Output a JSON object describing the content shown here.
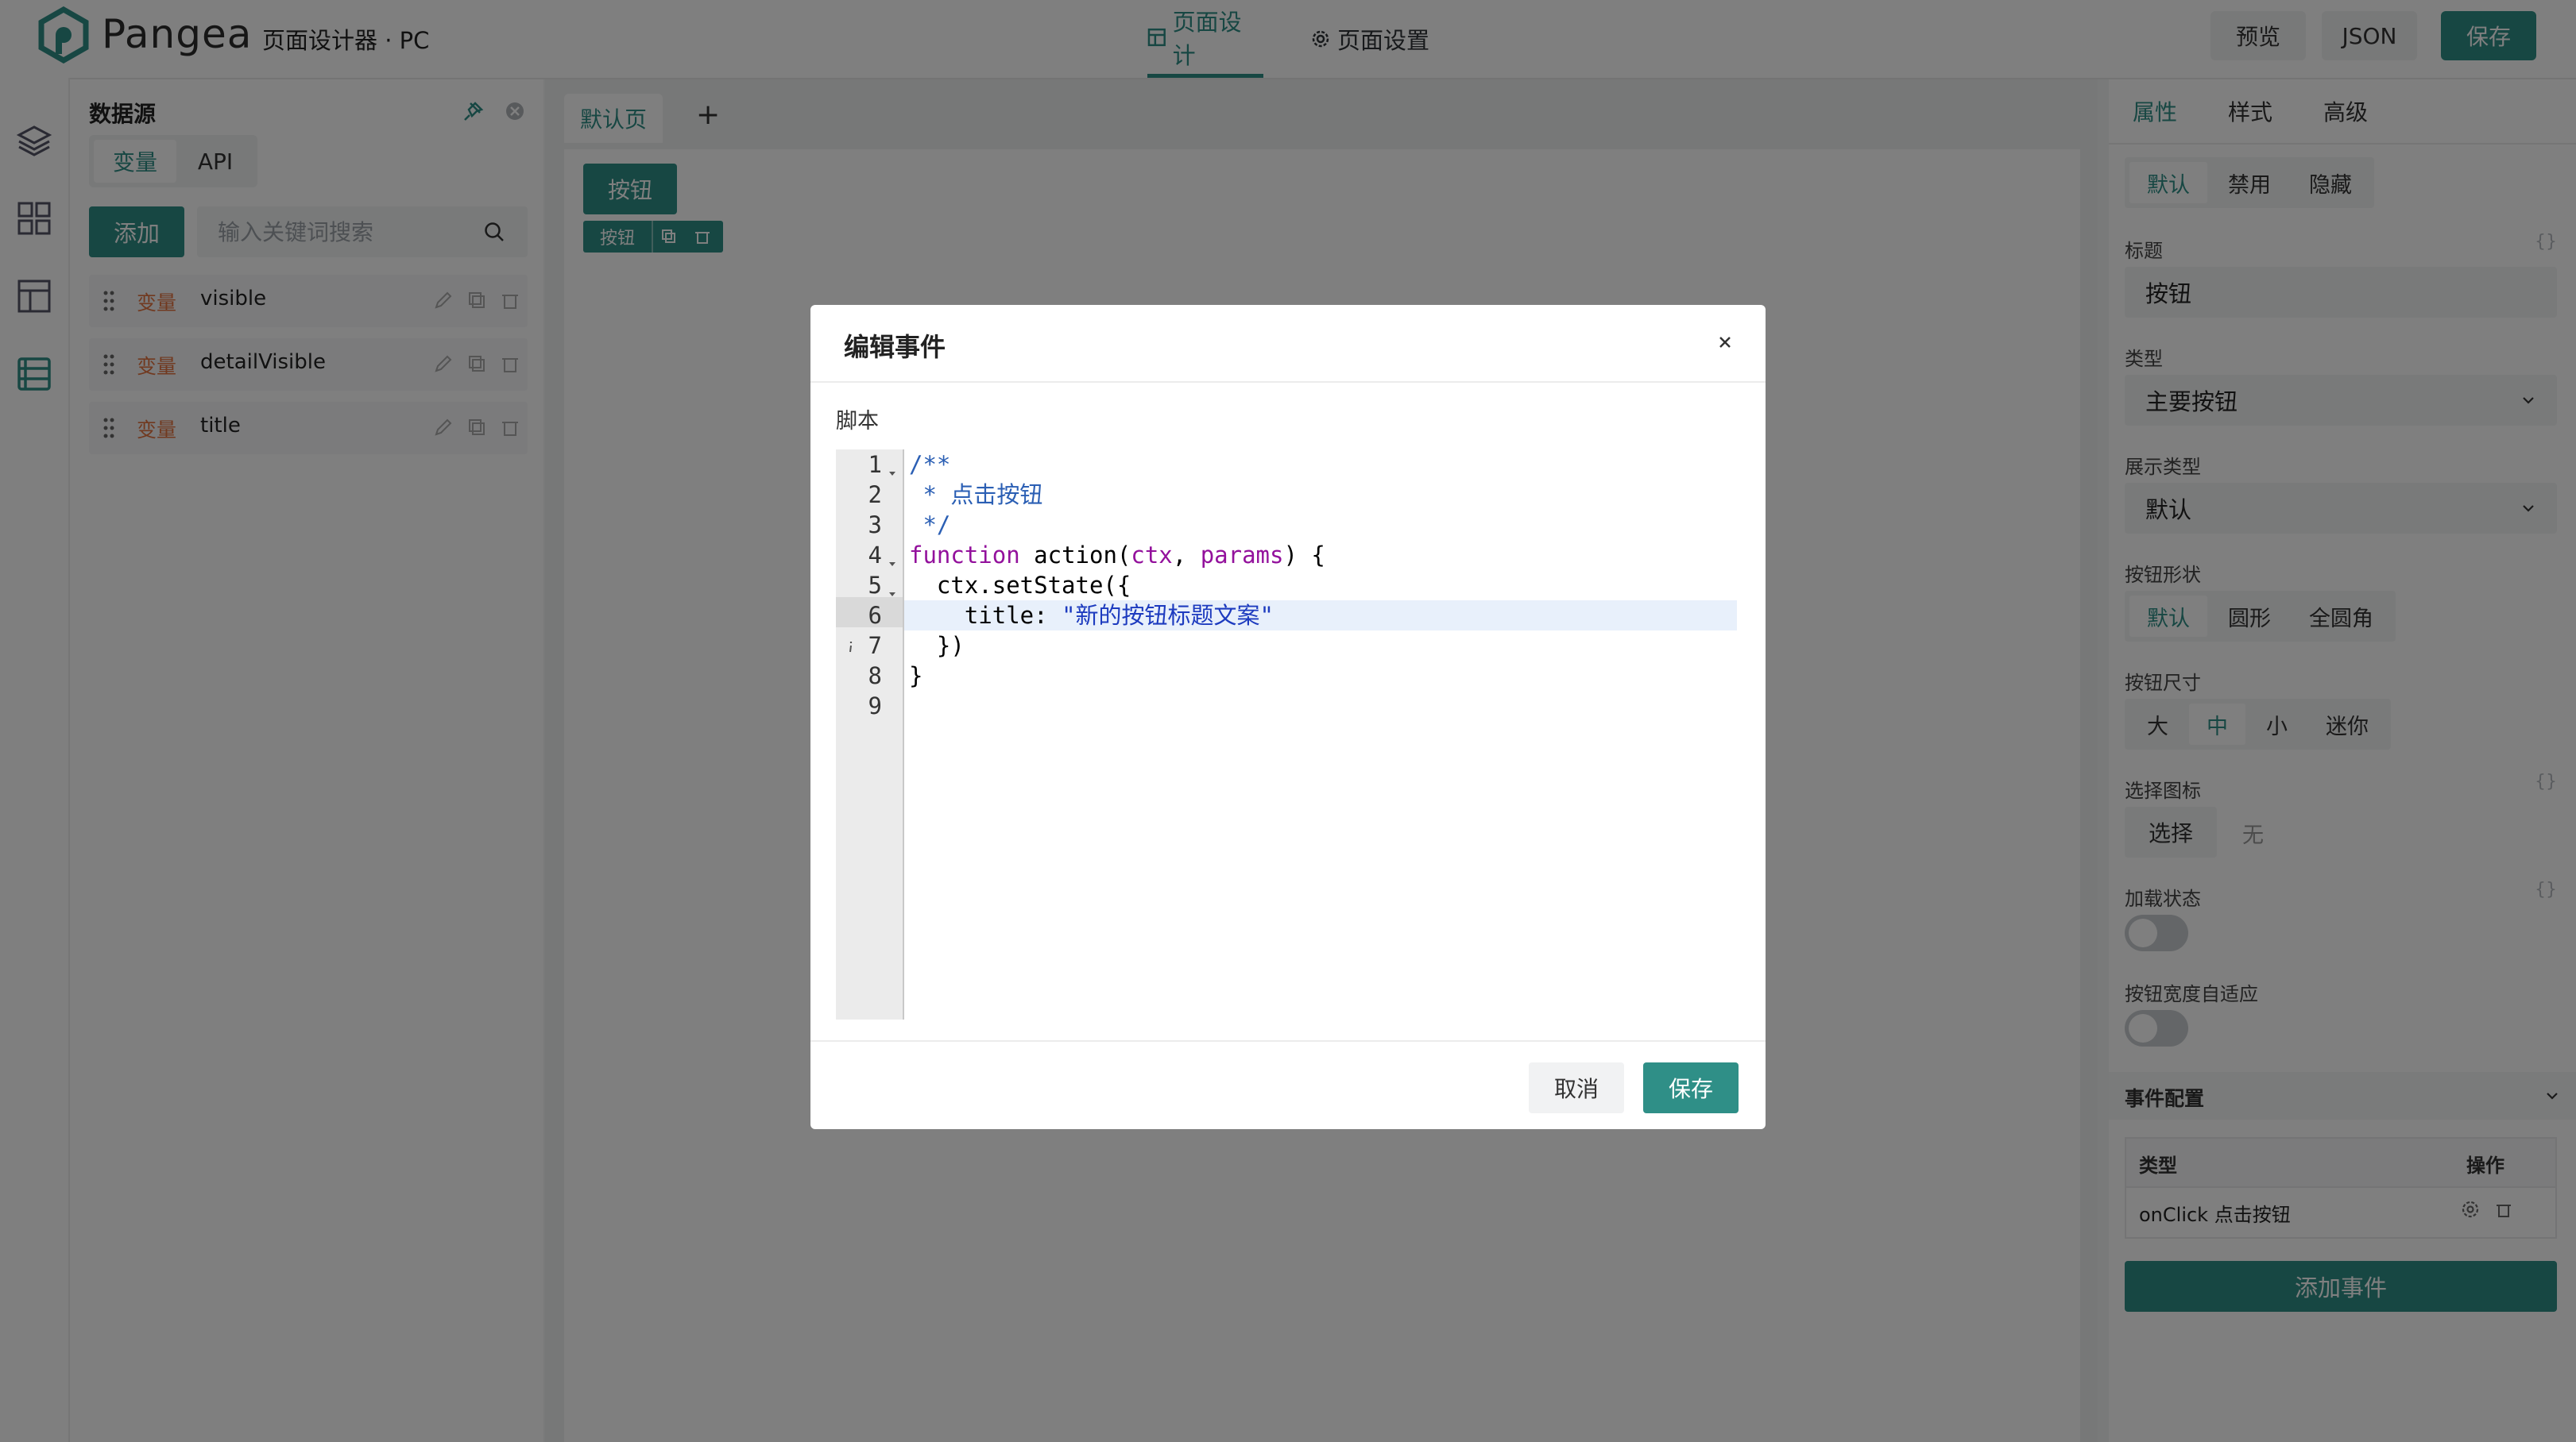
{
  "app": {
    "logo_text": "Pangea",
    "subtitle": "页面设计器 · PC"
  },
  "header": {
    "tabs": [
      {
        "label": "页面设计",
        "icon": "layout-icon",
        "active": true
      },
      {
        "label": "页面设置",
        "icon": "gear-icon",
        "active": false
      }
    ],
    "buttons": {
      "preview": "预览",
      "json": "JSON",
      "save": "保存"
    }
  },
  "rail": {
    "icons": [
      "layers-icon",
      "components-icon",
      "layout-icon",
      "datasource-icon"
    ]
  },
  "datasource": {
    "title": "数据源",
    "tabs": [
      "变量",
      "API"
    ],
    "active_tab": "变量",
    "add_label": "添加",
    "search_placeholder": "输入关键词搜索",
    "items": [
      {
        "tag": "变量",
        "name": "visible"
      },
      {
        "tag": "变量",
        "name": "detailVisible"
      },
      {
        "tag": "变量",
        "name": "title"
      }
    ]
  },
  "canvas": {
    "page_tab": "默认页",
    "add_page": "+",
    "component_label": "按钮",
    "toolbar_label": "按钮"
  },
  "props": {
    "tabs": [
      "属性",
      "样式",
      "高级"
    ],
    "active_tab": "属性",
    "state_options": [
      "默认",
      "禁用",
      "隐藏"
    ],
    "title_label": "标题",
    "title_value": "按钮",
    "type_label": "类型",
    "type_value": "主要按钮",
    "display_type_label": "展示类型",
    "display_type_value": "默认",
    "shape_label": "按钮形状",
    "shape_options": [
      "默认",
      "圆形",
      "全圆角"
    ],
    "size_label": "按钮尺寸",
    "size_options": [
      "大",
      "中",
      "小",
      "迷你"
    ],
    "icon_label": "选择图标",
    "icon_select": "选择",
    "icon_none": "无",
    "loading_label": "加载状态",
    "autowidth_label": "按钮宽度自适应",
    "events_section": "事件配置",
    "events_table": {
      "col_type": "类型",
      "col_action": "操作",
      "rows": [
        {
          "event": "onClick 点击按钮"
        }
      ]
    },
    "add_event": "添加事件",
    "braces": "{}"
  },
  "modal": {
    "title": "编辑事件",
    "script_label": "脚本",
    "cancel": "取消",
    "save": "保存",
    "code_lines": [
      "/**",
      " * 点击按钮",
      " */",
      "function action(ctx, params) {",
      "  ctx.setState({",
      "    title: \"新的按钮标题文案\"",
      "  })",
      "}",
      ""
    ],
    "line_numbers": [
      "1",
      "2",
      "3",
      "4",
      "5",
      "6",
      "7",
      "8",
      "9"
    ],
    "active_line": 6
  },
  "colors": {
    "accent": "#2f8f87",
    "var_tag": "#e2733f",
    "overlay": "rgba(0,0,0,0.5)"
  }
}
